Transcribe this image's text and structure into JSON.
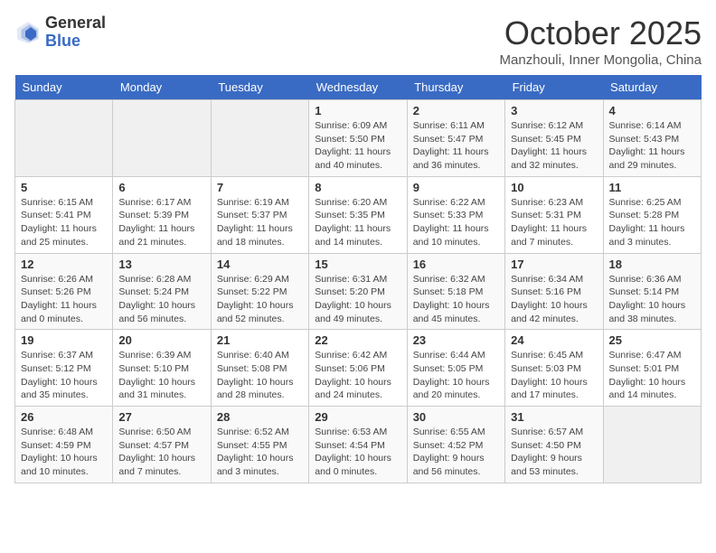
{
  "logo": {
    "general": "General",
    "blue": "Blue"
  },
  "header": {
    "month": "October 2025",
    "location": "Manzhouli, Inner Mongolia, China"
  },
  "weekdays": [
    "Sunday",
    "Monday",
    "Tuesday",
    "Wednesday",
    "Thursday",
    "Friday",
    "Saturday"
  ],
  "weeks": [
    [
      {
        "day": "",
        "info": ""
      },
      {
        "day": "",
        "info": ""
      },
      {
        "day": "",
        "info": ""
      },
      {
        "day": "1",
        "info": "Sunrise: 6:09 AM\nSunset: 5:50 PM\nDaylight: 11 hours\nand 40 minutes."
      },
      {
        "day": "2",
        "info": "Sunrise: 6:11 AM\nSunset: 5:47 PM\nDaylight: 11 hours\nand 36 minutes."
      },
      {
        "day": "3",
        "info": "Sunrise: 6:12 AM\nSunset: 5:45 PM\nDaylight: 11 hours\nand 32 minutes."
      },
      {
        "day": "4",
        "info": "Sunrise: 6:14 AM\nSunset: 5:43 PM\nDaylight: 11 hours\nand 29 minutes."
      }
    ],
    [
      {
        "day": "5",
        "info": "Sunrise: 6:15 AM\nSunset: 5:41 PM\nDaylight: 11 hours\nand 25 minutes."
      },
      {
        "day": "6",
        "info": "Sunrise: 6:17 AM\nSunset: 5:39 PM\nDaylight: 11 hours\nand 21 minutes."
      },
      {
        "day": "7",
        "info": "Sunrise: 6:19 AM\nSunset: 5:37 PM\nDaylight: 11 hours\nand 18 minutes."
      },
      {
        "day": "8",
        "info": "Sunrise: 6:20 AM\nSunset: 5:35 PM\nDaylight: 11 hours\nand 14 minutes."
      },
      {
        "day": "9",
        "info": "Sunrise: 6:22 AM\nSunset: 5:33 PM\nDaylight: 11 hours\nand 10 minutes."
      },
      {
        "day": "10",
        "info": "Sunrise: 6:23 AM\nSunset: 5:31 PM\nDaylight: 11 hours\nand 7 minutes."
      },
      {
        "day": "11",
        "info": "Sunrise: 6:25 AM\nSunset: 5:28 PM\nDaylight: 11 hours\nand 3 minutes."
      }
    ],
    [
      {
        "day": "12",
        "info": "Sunrise: 6:26 AM\nSunset: 5:26 PM\nDaylight: 11 hours\nand 0 minutes."
      },
      {
        "day": "13",
        "info": "Sunrise: 6:28 AM\nSunset: 5:24 PM\nDaylight: 10 hours\nand 56 minutes."
      },
      {
        "day": "14",
        "info": "Sunrise: 6:29 AM\nSunset: 5:22 PM\nDaylight: 10 hours\nand 52 minutes."
      },
      {
        "day": "15",
        "info": "Sunrise: 6:31 AM\nSunset: 5:20 PM\nDaylight: 10 hours\nand 49 minutes."
      },
      {
        "day": "16",
        "info": "Sunrise: 6:32 AM\nSunset: 5:18 PM\nDaylight: 10 hours\nand 45 minutes."
      },
      {
        "day": "17",
        "info": "Sunrise: 6:34 AM\nSunset: 5:16 PM\nDaylight: 10 hours\nand 42 minutes."
      },
      {
        "day": "18",
        "info": "Sunrise: 6:36 AM\nSunset: 5:14 PM\nDaylight: 10 hours\nand 38 minutes."
      }
    ],
    [
      {
        "day": "19",
        "info": "Sunrise: 6:37 AM\nSunset: 5:12 PM\nDaylight: 10 hours\nand 35 minutes."
      },
      {
        "day": "20",
        "info": "Sunrise: 6:39 AM\nSunset: 5:10 PM\nDaylight: 10 hours\nand 31 minutes."
      },
      {
        "day": "21",
        "info": "Sunrise: 6:40 AM\nSunset: 5:08 PM\nDaylight: 10 hours\nand 28 minutes."
      },
      {
        "day": "22",
        "info": "Sunrise: 6:42 AM\nSunset: 5:06 PM\nDaylight: 10 hours\nand 24 minutes."
      },
      {
        "day": "23",
        "info": "Sunrise: 6:44 AM\nSunset: 5:05 PM\nDaylight: 10 hours\nand 20 minutes."
      },
      {
        "day": "24",
        "info": "Sunrise: 6:45 AM\nSunset: 5:03 PM\nDaylight: 10 hours\nand 17 minutes."
      },
      {
        "day": "25",
        "info": "Sunrise: 6:47 AM\nSunset: 5:01 PM\nDaylight: 10 hours\nand 14 minutes."
      }
    ],
    [
      {
        "day": "26",
        "info": "Sunrise: 6:48 AM\nSunset: 4:59 PM\nDaylight: 10 hours\nand 10 minutes."
      },
      {
        "day": "27",
        "info": "Sunrise: 6:50 AM\nSunset: 4:57 PM\nDaylight: 10 hours\nand 7 minutes."
      },
      {
        "day": "28",
        "info": "Sunrise: 6:52 AM\nSunset: 4:55 PM\nDaylight: 10 hours\nand 3 minutes."
      },
      {
        "day": "29",
        "info": "Sunrise: 6:53 AM\nSunset: 4:54 PM\nDaylight: 10 hours\nand 0 minutes."
      },
      {
        "day": "30",
        "info": "Sunrise: 6:55 AM\nSunset: 4:52 PM\nDaylight: 9 hours\nand 56 minutes."
      },
      {
        "day": "31",
        "info": "Sunrise: 6:57 AM\nSunset: 4:50 PM\nDaylight: 9 hours\nand 53 minutes."
      },
      {
        "day": "",
        "info": ""
      }
    ]
  ]
}
